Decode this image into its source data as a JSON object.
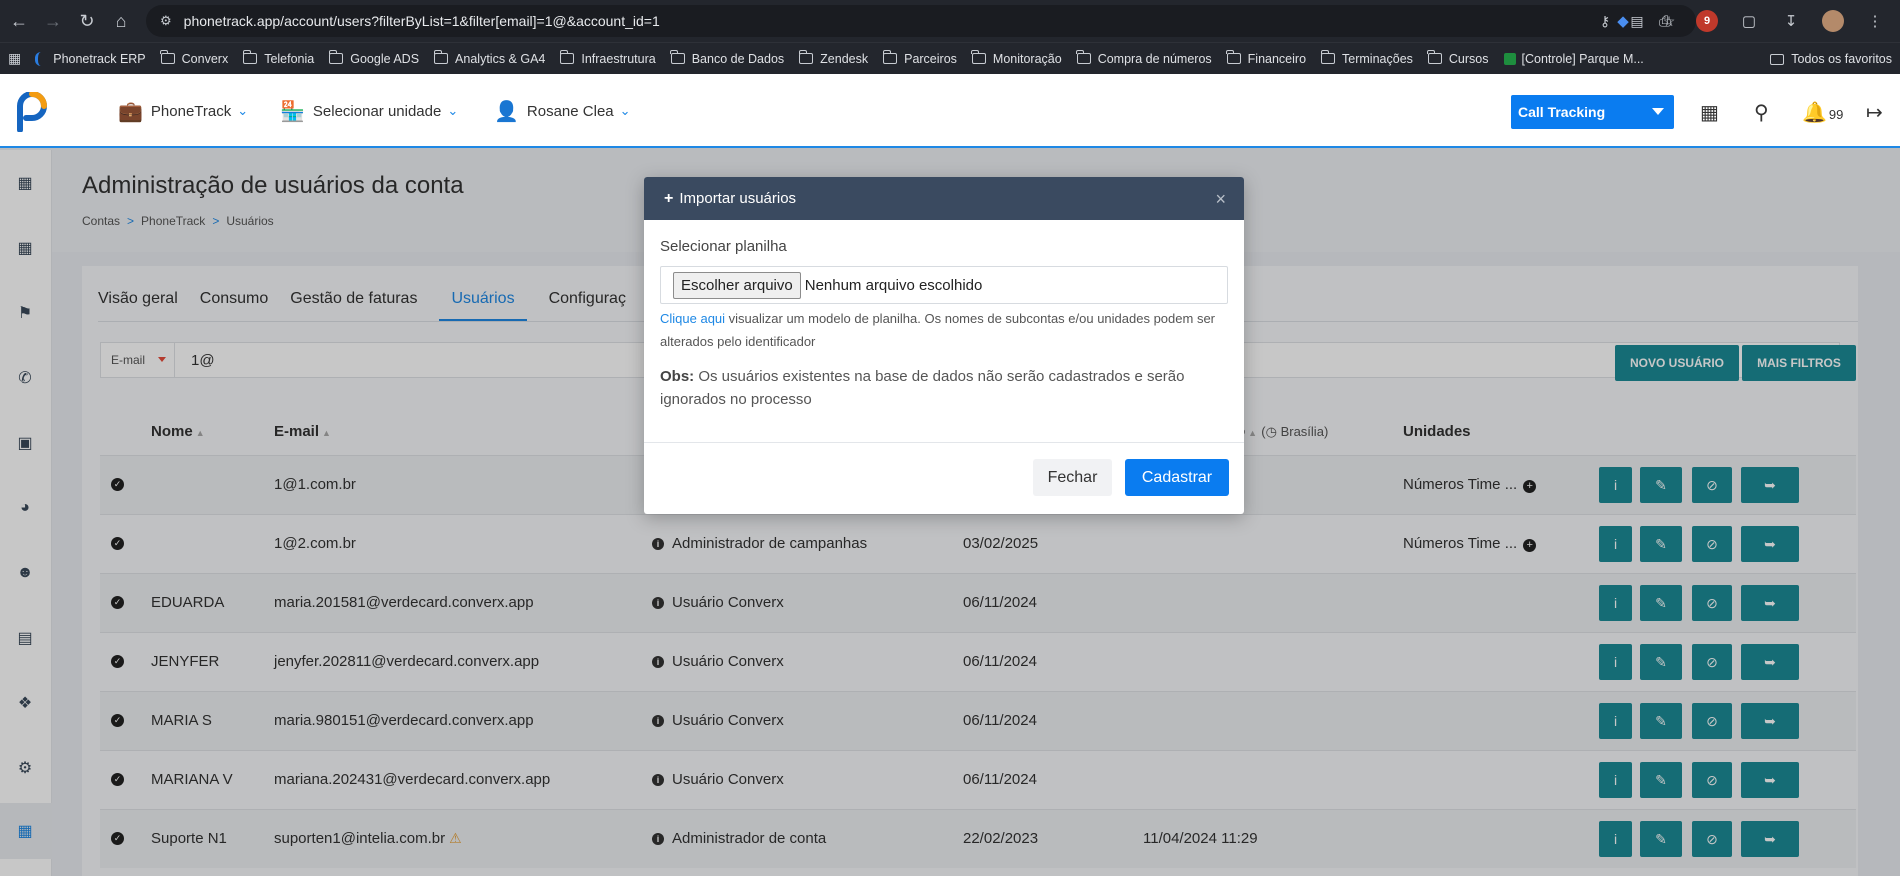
{
  "browser": {
    "url": "phonetrack.app/account/users?filterByList=1&filter[email]=1@&account_id=1",
    "bookmarks": [
      "Phonetrack ERP",
      "Converx",
      "Telefonia",
      "Google ADS",
      "Analytics & GA4",
      "Infraestrutura",
      "Banco de Dados",
      "Zendesk",
      "Parceiros",
      "Monitoração",
      "Compra de números",
      "Financeiro",
      "Terminações",
      "Cursos",
      "[Controle] Parque M..."
    ],
    "bookmarks_right": "Todos os favoritos",
    "ext_badge": "9"
  },
  "header": {
    "company": "PhoneTrack",
    "unit": "Selecionar unidade",
    "user": "Rosane Clea",
    "product": "Call Tracking",
    "notifications": "99"
  },
  "page": {
    "title": "Administração de usuários da conta",
    "breadcrumb": [
      "Contas",
      "PhoneTrack",
      "Usuários"
    ],
    "tabs": [
      "Visão geral",
      "Consumo",
      "Gestão de faturas",
      "Usuários",
      "Configuraç"
    ],
    "filter": {
      "field": "E-mail",
      "value": "1@"
    },
    "buttons": {
      "new_user": "NOVO USUÁRIO",
      "more_filters": "MAIS FILTROS"
    }
  },
  "table": {
    "headers": {
      "name": "Nome",
      "email": "E-mail",
      "last_access": "o",
      "timezone": "Brasília",
      "units": "Unidades"
    },
    "rows": [
      {
        "name": "",
        "email": "1@1.com.br",
        "role": "",
        "created": "",
        "last_access": "",
        "units": "Números Time ..."
      },
      {
        "name": "",
        "email": "1@2.com.br",
        "role": "Administrador de campanhas",
        "created": "03/02/2025",
        "last_access": "",
        "units": "Números Time ..."
      },
      {
        "name": "EDUARDA",
        "email": "maria.201581@verdecard.converx.app",
        "role": "Usuário Converx",
        "created": "06/11/2024",
        "last_access": "",
        "units": ""
      },
      {
        "name": "JENYFER",
        "email": "jenyfer.202811@verdecard.converx.app",
        "role": "Usuário Converx",
        "created": "06/11/2024",
        "last_access": "",
        "units": ""
      },
      {
        "name": "MARIA S",
        "email": "maria.980151@verdecard.converx.app",
        "role": "Usuário Converx",
        "created": "06/11/2024",
        "last_access": "",
        "units": ""
      },
      {
        "name": "MARIANA V",
        "email": "mariana.202431@verdecard.converx.app",
        "role": "Usuário Converx",
        "created": "06/11/2024",
        "last_access": "",
        "units": ""
      },
      {
        "name": "Suporte N1",
        "email": "suporten1@intelia.com.br",
        "role": "Administrador de conta",
        "created": "22/02/2023",
        "last_access": "11/04/2024 11:29",
        "units": ""
      }
    ]
  },
  "modal": {
    "title": "Importar usuários",
    "label": "Selecionar planilha",
    "file_button": "Escolher arquivo",
    "file_name": "Nenhum arquivo escolhido",
    "help_link": "Clique aqui",
    "help_text": " visualizar um modelo de planilha. Os nomes de subcontas e/ou unidades podem ser alterados pelo identificador",
    "obs_label": "Obs:",
    "obs_text": " Os usuários existentes na base de dados não serão cadastrados e serão ignorados no processo",
    "close_label": "Fechar",
    "submit_label": "Cadastrar"
  },
  "colors": {
    "accent": "#0a7cf0",
    "teal": "#1b8b96",
    "modal_header": "#3a4a60"
  }
}
